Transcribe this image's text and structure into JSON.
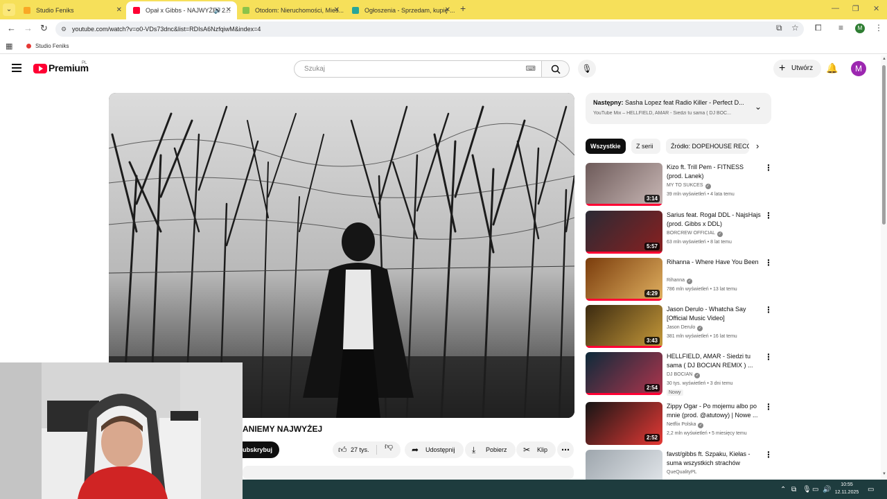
{
  "browser": {
    "tabs": [
      {
        "title": "Studio Feniks",
        "fav_color": "#f9a825"
      },
      {
        "title": "Opał x Gibbs - NAJWYŻEJ 2...",
        "fav_color": "#ff0033"
      },
      {
        "title": "Otodom: Nieruchomości, Mies...",
        "fav_color": "#8bc34a"
      },
      {
        "title": "Ogłoszenia - Sprzedam, kupię ...",
        "fav_color": "#26a69a"
      }
    ],
    "url": "youtube.com/watch?v=o0-VDs73dnc&list=RDIsA6NzfqiwM&index=4",
    "profile_initial": "M",
    "bookmark": "Studio Feniks"
  },
  "yt": {
    "brand": "Premium",
    "brand_suffix": "PL",
    "search_placeholder": "Szukaj",
    "create_label": "Utwórz",
    "avatar_initial": "M"
  },
  "video": {
    "title": "ANIEMY NAJWYŻEJ",
    "subscribe": "ubskrybuj",
    "likes": "27 tys.",
    "share": "Udostępnij",
    "download": "Pobierz",
    "clip": "Klip"
  },
  "playlist": {
    "next_label": "Następny:",
    "next_title": "Sasha Lopez feat Radio Killer - Perfect D...",
    "subtitle": "YouTube Mix – HELLFIELD, AMAR - Siedzi tu sama ( DJ BOC..."
  },
  "chips": [
    "Wszystkie",
    "Z serii",
    "Źródło: DOPEHOUSE RECO"
  ],
  "recommendations": [
    {
      "title": "Kizo ft. Trill Pem - FITNESS (prod. Lanek)",
      "channel": "MY TO SUKCES",
      "verified": true,
      "meta": "39 mln wyświetleń • 4 lata temu",
      "duration": "3:14",
      "badge": "",
      "thumb": [
        "#6d5a59",
        "#c9b8b6"
      ],
      "progress": 1
    },
    {
      "title": "Sarius feat. Rogal DDL - NajsHajs (prod. Gibbs x DDL)",
      "channel": "BORCREW OFFICIAL",
      "verified": true,
      "meta": "63 mln wyświetleń • 8 lat temu",
      "duration": "5:57",
      "badge": "",
      "thumb": [
        "#2a2a34",
        "#8a2020"
      ],
      "progress": 1
    },
    {
      "title": "Rihanna - Where Have You Been",
      "channel": "Rihanna",
      "verified": true,
      "meta": "786 mln wyświetleń • 13 lat temu",
      "duration": "4:29",
      "badge": "",
      "thumb": [
        "#7a3c0c",
        "#e0b060"
      ],
      "progress": 1
    },
    {
      "title": "Jason Derulo - Whatcha Say [Official Music Video]",
      "channel": "Jason Derulo",
      "verified": true,
      "meta": "381 mln wyświetleń • 16 lat temu",
      "duration": "3:43",
      "badge": "",
      "thumb": [
        "#3b2a10",
        "#c79a3a"
      ],
      "progress": 1
    },
    {
      "title": "HELLFIELD, AMAR - Siedzi tu sama ( DJ BOCIAN REMIX ) ...",
      "channel": "DJ BOCIAN",
      "verified": true,
      "meta": "30 tys. wyświetleń • 3 dni temu",
      "duration": "2:54",
      "badge": "Nowy",
      "thumb": [
        "#0d2a3a",
        "#b0354d"
      ],
      "progress": 1
    },
    {
      "title": "Zippy Ogar - Po mojemu albo po mnie (prod. @atutowy) | Nowe ...",
      "channel": "Netflix Polska",
      "verified": true,
      "meta": "2,2 mln wyświetleń • 5 miesięcy temu",
      "duration": "2:52",
      "badge": "",
      "thumb": [
        "#151515",
        "#e53935"
      ],
      "progress": 0
    },
    {
      "title": "favst/gibbs ft. Szpaku, Kiełas - suma wszystkich strachów",
      "channel": "QueQualityPL",
      "verified": false,
      "meta": "",
      "duration": "",
      "badge": "",
      "thumb": [
        "#9ea6ad",
        "#e6eaee"
      ],
      "progress": 0
    }
  ],
  "taskbar": {
    "time": "10:55",
    "date": "12.11.2025"
  }
}
